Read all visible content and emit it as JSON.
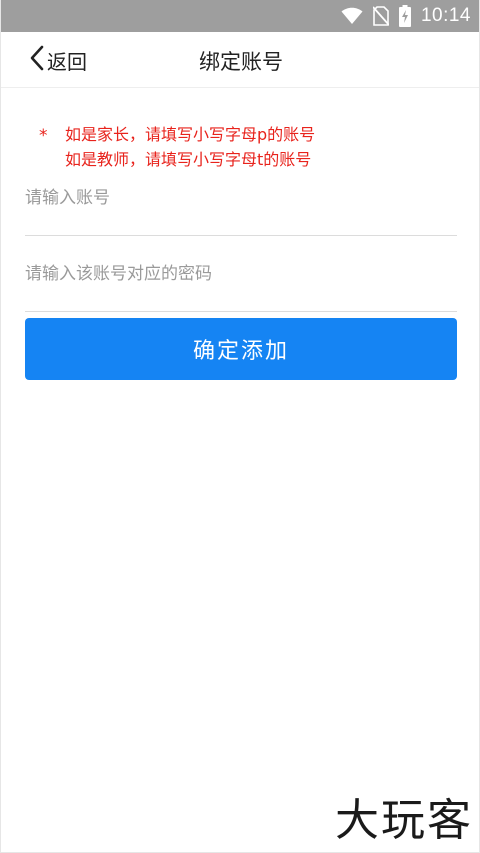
{
  "status_bar": {
    "time": "10:14",
    "icons": [
      "wifi-icon",
      "no-sim-icon",
      "battery-charging-icon"
    ]
  },
  "nav": {
    "back_label": "返回",
    "title": "绑定账号"
  },
  "notice": {
    "marker": "*",
    "line1": "如是家长，请填写小写字母p的账号",
    "line2": "如是教师，请填写小写字母t的账号",
    "color": "#e8231c"
  },
  "form": {
    "account_placeholder": "请输入账号",
    "password_placeholder": "请输入该账号对应的密码",
    "submit_label": "确定添加"
  },
  "watermark": {
    "text": "大玩客"
  },
  "colors": {
    "accent": "#1584f3",
    "status_bar": "#9e9e9e"
  }
}
